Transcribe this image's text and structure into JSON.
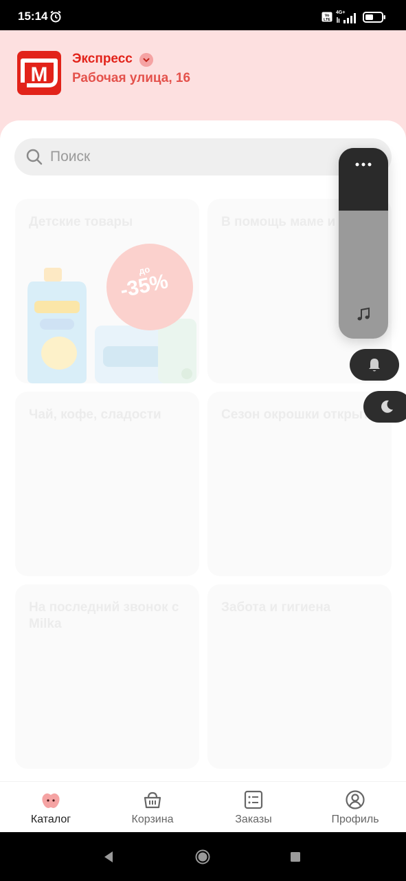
{
  "status_bar": {
    "time": "15:14",
    "network_label": "4G+"
  },
  "header": {
    "brand_logo_letter": "М",
    "store_name": "Экспресс",
    "address": "Рабочая улица, 16"
  },
  "search": {
    "placeholder": "Поиск"
  },
  "catalog": {
    "cards": [
      {
        "title": "Детские товары",
        "promo_prefix": "до",
        "promo": "-35%"
      },
      {
        "title": "В помощь маме и папе!"
      },
      {
        "title": "Чай, кофе, сладости"
      },
      {
        "title": "Сезон окрошки открыт"
      },
      {
        "title": "На последний звонок с Milka"
      },
      {
        "title": "Забота и гигиена"
      }
    ]
  },
  "overlay": {
    "icons": [
      "more-icon",
      "music-icon",
      "bell-icon",
      "moon-icon"
    ],
    "panel_fill_fraction": 0.67
  },
  "bottom_nav": {
    "items": [
      {
        "label": "Каталог",
        "icon": "apple-icon",
        "active": true
      },
      {
        "label": "Корзина",
        "icon": "basket-icon"
      },
      {
        "label": "Заказы",
        "icon": "orders-list-icon"
      },
      {
        "label": "Профиль",
        "icon": "profile-icon"
      }
    ]
  },
  "colors": {
    "brand_red": "#e2231a",
    "header_bg": "#fde0e0",
    "overlay_dark": "#2d2d2d"
  }
}
